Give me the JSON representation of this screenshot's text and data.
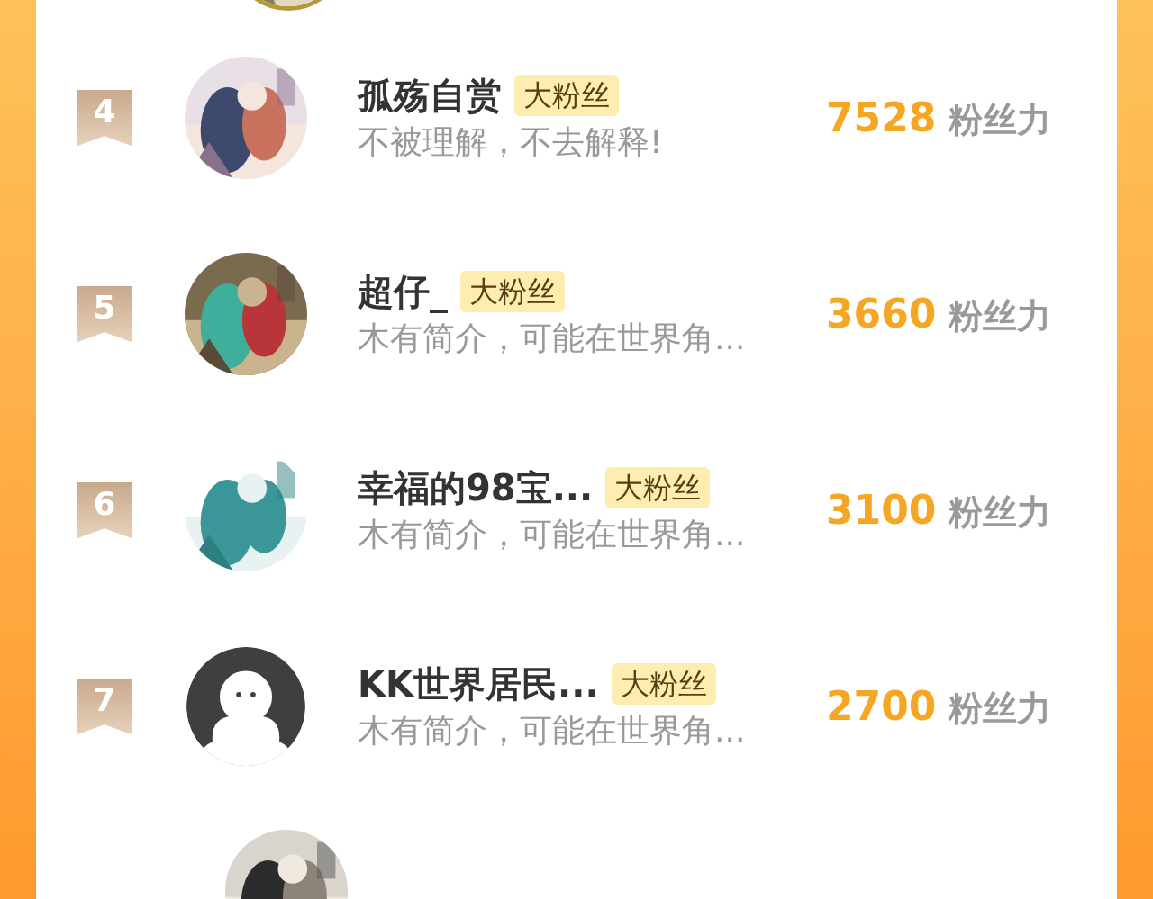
{
  "rows": [
    {
      "rank": "4",
      "name": "孤殇自赏",
      "badge": "大粉丝",
      "bio": "不被理解，不去解释!",
      "score": "7528",
      "unit": "粉丝力"
    },
    {
      "rank": "5",
      "name": "超仔_",
      "badge": "大粉丝",
      "bio": "木有简介，可能在世界角...",
      "score": "3660",
      "unit": "粉丝力"
    },
    {
      "rank": "6",
      "name": "幸福的98宝...",
      "badge": "大粉丝",
      "bio": "木有简介，可能在世界角...",
      "score": "3100",
      "unit": "粉丝力"
    },
    {
      "rank": "7",
      "avatar": {
        "kind": "default"
      },
      "name": "KK世界居民...",
      "badge": "大粉丝",
      "bio": "木有简介，可能在世界角...",
      "score": "2700",
      "unit": "粉丝力"
    }
  ]
}
